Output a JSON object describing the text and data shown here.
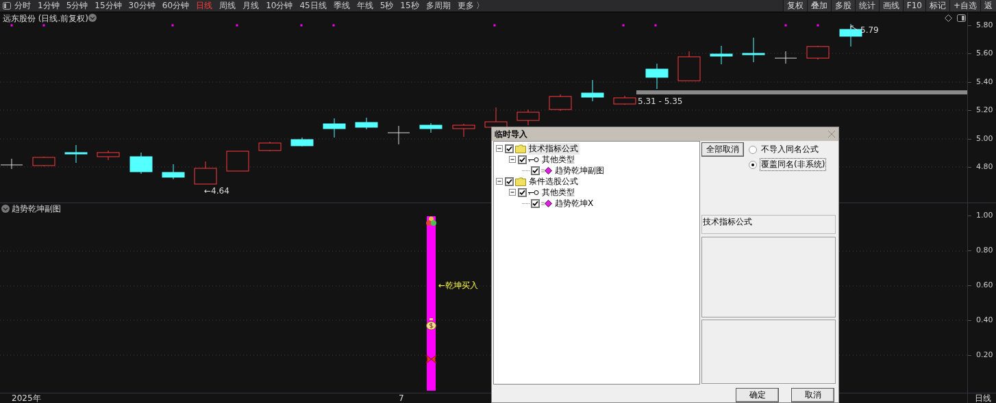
{
  "toolbar": {
    "periods": [
      {
        "label": "分时",
        "selected": false
      },
      {
        "label": "1分钟",
        "selected": false
      },
      {
        "label": "5分钟",
        "selected": false
      },
      {
        "label": "15分钟",
        "selected": false
      },
      {
        "label": "30分钟",
        "selected": false
      },
      {
        "label": "60分钟",
        "selected": false
      },
      {
        "label": "日线",
        "selected": true
      },
      {
        "label": "周线",
        "selected": false
      },
      {
        "label": "月线",
        "selected": false
      },
      {
        "label": "10分钟",
        "selected": false
      },
      {
        "label": "45日线",
        "selected": false
      },
      {
        "label": "季线",
        "selected": false
      },
      {
        "label": "年线",
        "selected": false
      },
      {
        "label": "5秒",
        "selected": false
      },
      {
        "label": "15秒",
        "selected": false
      },
      {
        "label": "多周期",
        "selected": false
      }
    ],
    "more": "更多 〉",
    "actions": [
      "复权",
      "叠加",
      "多股",
      "统计",
      "画线",
      "F10",
      "标记",
      "+自选",
      "返"
    ]
  },
  "main_chart": {
    "title": "远东股份 (日线.前复权)",
    "y_ticks": [
      "5.80",
      "5.60",
      "5.40",
      "5.20",
      "5.00",
      "4.80"
    ],
    "high_label": "5.79",
    "range_label": "5.31 - 5.35",
    "low_label": "←4.64"
  },
  "sub_chart": {
    "title": "趋势乾坤副图",
    "y_ticks": [
      "1.00",
      "0.80",
      "0.60",
      "0.40",
      "0.20"
    ],
    "signal_label": "←乾坤买入"
  },
  "x_axis": {
    "year": "2025年",
    "month": "7",
    "period": "日线"
  },
  "dialog": {
    "title": "临时导入",
    "tree": [
      {
        "label": "技术指标公式",
        "kind": "folder",
        "checked": true,
        "expanded": true,
        "selected": true,
        "children": [
          {
            "label": "其他类型",
            "kind": "type",
            "checked": true,
            "expanded": true,
            "selected": false,
            "children": [
              {
                "label": "趋势乾坤副图",
                "kind": "formula",
                "checked": true,
                "selected": false
              }
            ]
          }
        ]
      },
      {
        "label": "条件选股公式",
        "kind": "folder",
        "checked": true,
        "expanded": true,
        "selected": false,
        "children": [
          {
            "label": "其他类型",
            "kind": "type",
            "checked": true,
            "expanded": true,
            "selected": false,
            "children": [
              {
                "label": "趋势乾坤X",
                "kind": "formula",
                "checked": true,
                "selected": false
              }
            ]
          }
        ]
      }
    ],
    "cancel_all": "全部取消",
    "options": [
      {
        "label": "不导入同名公式",
        "selected": false
      },
      {
        "label": "覆盖同名(非系统)",
        "selected": true
      }
    ],
    "category": "技术指标公式",
    "buttons": [
      "确定",
      "取消"
    ]
  }
}
